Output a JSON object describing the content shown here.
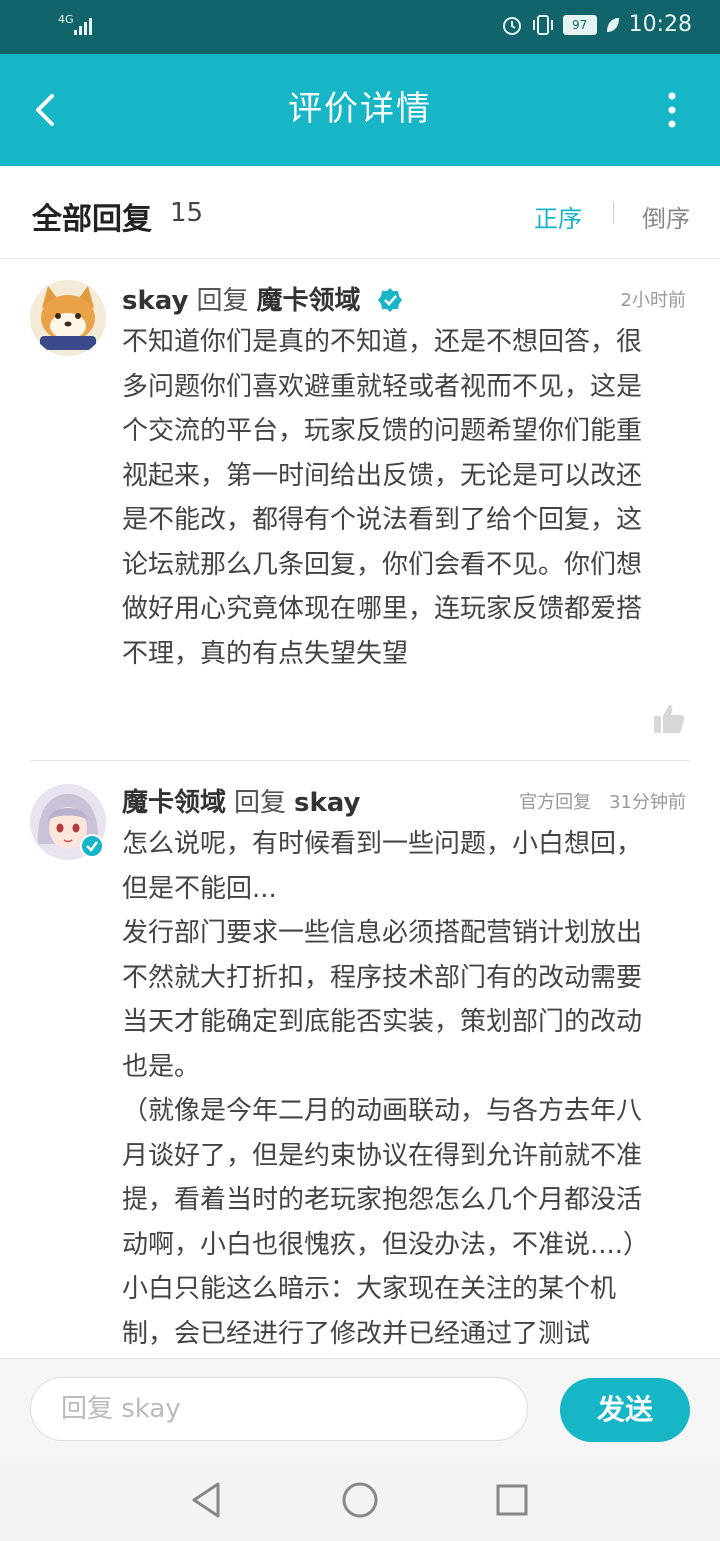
{
  "statusbar": {
    "network": "4G",
    "battery": "97",
    "time": "10:28"
  },
  "header": {
    "title": "评价详情"
  },
  "subhead": {
    "label": "全部回复",
    "count": "15",
    "sort_asc": "正序",
    "sort_desc": "倒序"
  },
  "comments": [
    {
      "user": "skay",
      "reply_word": "回复",
      "target": "魔卡领域",
      "time": "2小时前",
      "text": "不知道你们是真的不知道，还是不想回答，很\n多问题你们喜欢避重就轻或者视而不见，这是\n个交流的平台，玩家反馈的问题希望你们能重\n视起来，第一时间给出反馈，无论是可以改还\n是不能改，都得有个说法看到了给个回复，这\n论坛就那么几条回复，你们会看不见。你们想\n做好用心究竟体现在哪里，连玩家反馈都爱搭\n不理，真的有点失望失望"
    },
    {
      "user": "魔卡领域",
      "reply_word": "回复",
      "target": "skay",
      "official": "官方回复",
      "time": "31分钟前",
      "text": "怎么说呢，有时候看到一些问题，小白想回，\n但是不能回...\n发行部门要求一些信息必须搭配营销计划放出\n不然就大打折扣，程序技术部门有的改动需要\n当天才能确定到底能否实装，策划部门的改动\n也是。\n（就像是今年二月的动画联动，与各方去年八\n月谈好了，但是约束协议在得到允许前就不准\n提，看着当时的老玩家抱怨怎么几个月都没活\n动啊，小白也很愧疚，但没办法，不准说....）\n小白只能这么暗示：大家现在关注的某个机\n制，会已经进行了修改并已经通过了测试"
    }
  ],
  "reply": {
    "placeholder": "回复 skay",
    "send_label": "发送"
  },
  "colors": {
    "accent": "#17b6c6",
    "statusbar": "#10646a"
  }
}
